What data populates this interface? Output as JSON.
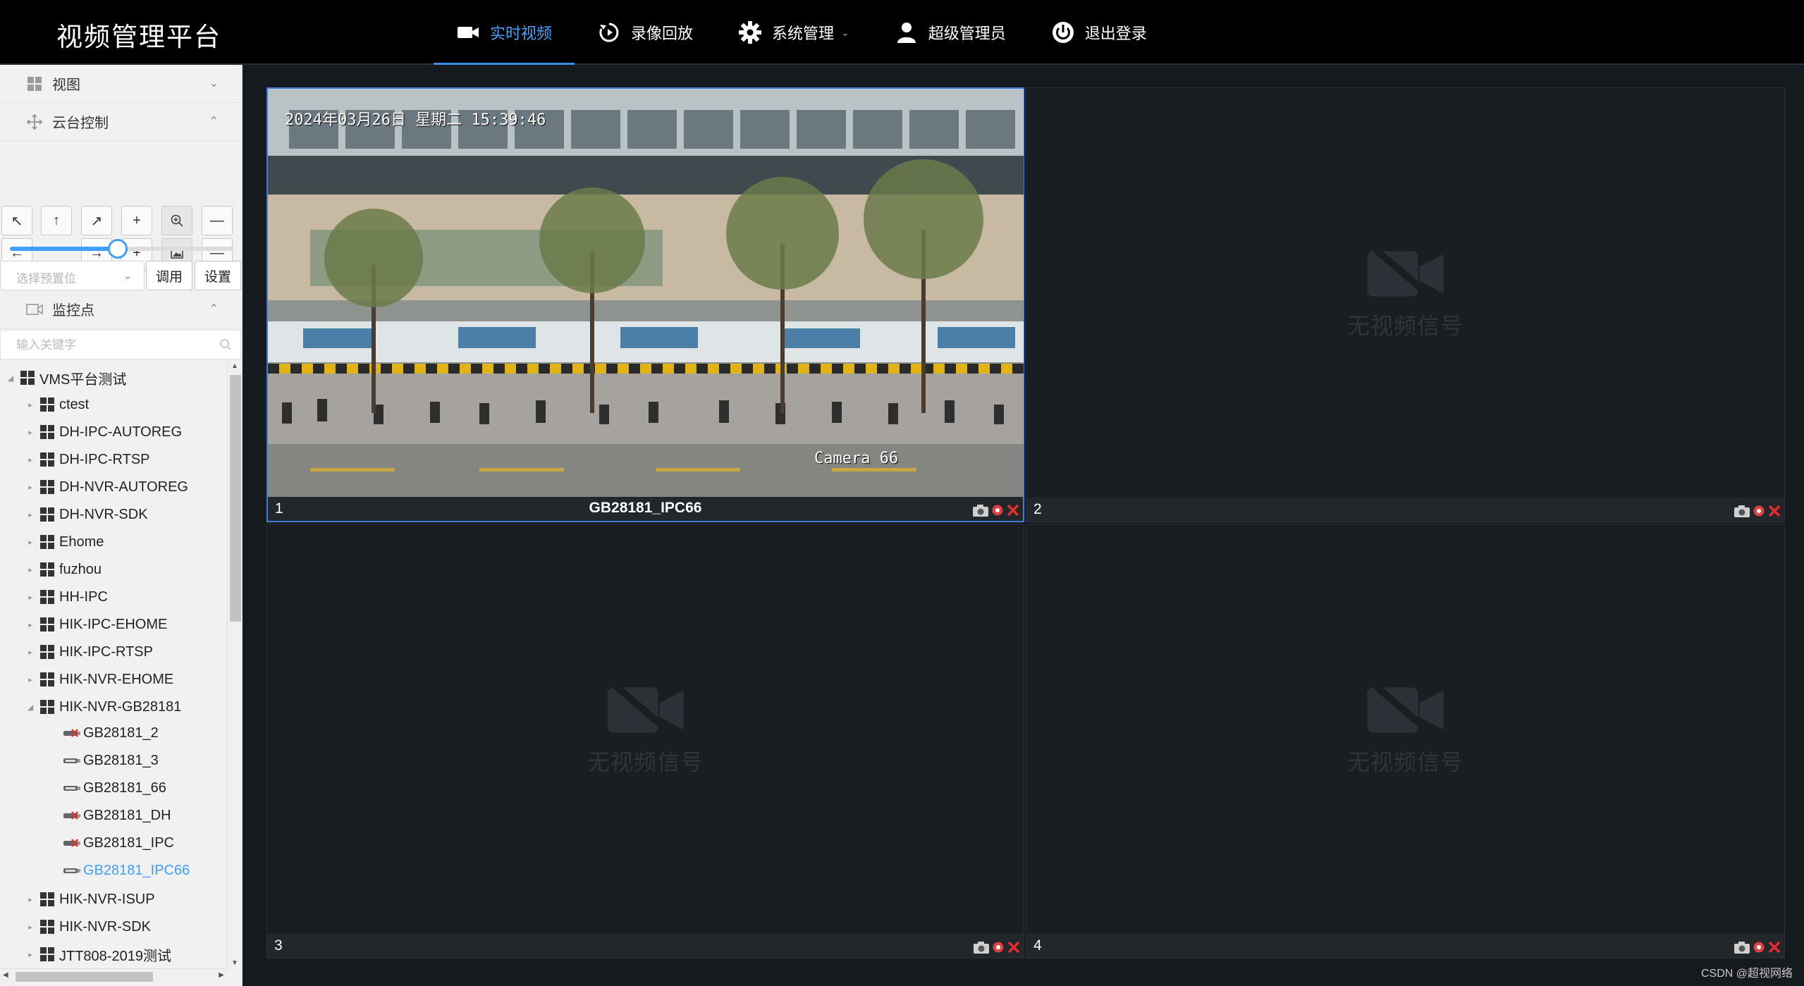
{
  "app": {
    "title": "视频管理平台"
  },
  "nav": {
    "items": [
      {
        "label": "实时视频",
        "icon": "video-camera-icon",
        "active": true
      },
      {
        "label": "录像回放",
        "icon": "replay-icon"
      },
      {
        "label": "系统管理",
        "icon": "gear-icon",
        "has_caret": true
      },
      {
        "label": "超级管理员",
        "icon": "user-icon"
      },
      {
        "label": "退出登录",
        "icon": "power-icon"
      }
    ]
  },
  "sidebar": {
    "view_label": "视图",
    "ptz_label": "云台控制",
    "ptz": {
      "speed_percent": 48,
      "preset_placeholder": "选择预置位",
      "call_label": "调用",
      "set_label": "设置"
    },
    "monitor_label": "监控点",
    "search_placeholder": "输入关键字",
    "tree": {
      "root": "VMS平台测试",
      "groups": [
        {
          "label": "ctest"
        },
        {
          "label": "DH-IPC-AUTOREG"
        },
        {
          "label": "DH-IPC-RTSP"
        },
        {
          "label": "DH-NVR-AUTOREG"
        },
        {
          "label": "DH-NVR-SDK"
        },
        {
          "label": "Ehome"
        },
        {
          "label": "fuzhou"
        },
        {
          "label": "HH-IPC"
        },
        {
          "label": "HIK-IPC-EHOME"
        },
        {
          "label": "HIK-IPC-RTSP"
        },
        {
          "label": "HIK-NVR-EHOME"
        },
        {
          "label": "HIK-NVR-GB28181",
          "expanded": true,
          "children": [
            {
              "label": "GB28181_2",
              "online": false
            },
            {
              "label": "GB28181_3",
              "online": true
            },
            {
              "label": "GB28181_66",
              "online": true
            },
            {
              "label": "GB28181_DH",
              "online": false
            },
            {
              "label": "GB28181_IPC",
              "online": false
            },
            {
              "label": "GB28181_IPC66",
              "online": true,
              "selected": true
            }
          ]
        },
        {
          "label": "HIK-NVR-ISUP"
        },
        {
          "label": "HIK-NVR-SDK"
        },
        {
          "label": "JTT808-2019测试"
        }
      ]
    }
  },
  "video": {
    "cells": [
      {
        "num": "1",
        "title": "GB28181_IPC66",
        "has_video": true,
        "active": true,
        "osd_date": "2024年03月26日 星期二 15:39:46",
        "osd_camera": "Camera 66"
      },
      {
        "num": "2",
        "title": "",
        "has_video": false
      },
      {
        "num": "3",
        "title": "",
        "has_video": false
      },
      {
        "num": "4",
        "title": "",
        "has_video": false
      }
    ],
    "no_signal_text": "无视频信号"
  },
  "watermark": "CSDN @超视网络"
}
